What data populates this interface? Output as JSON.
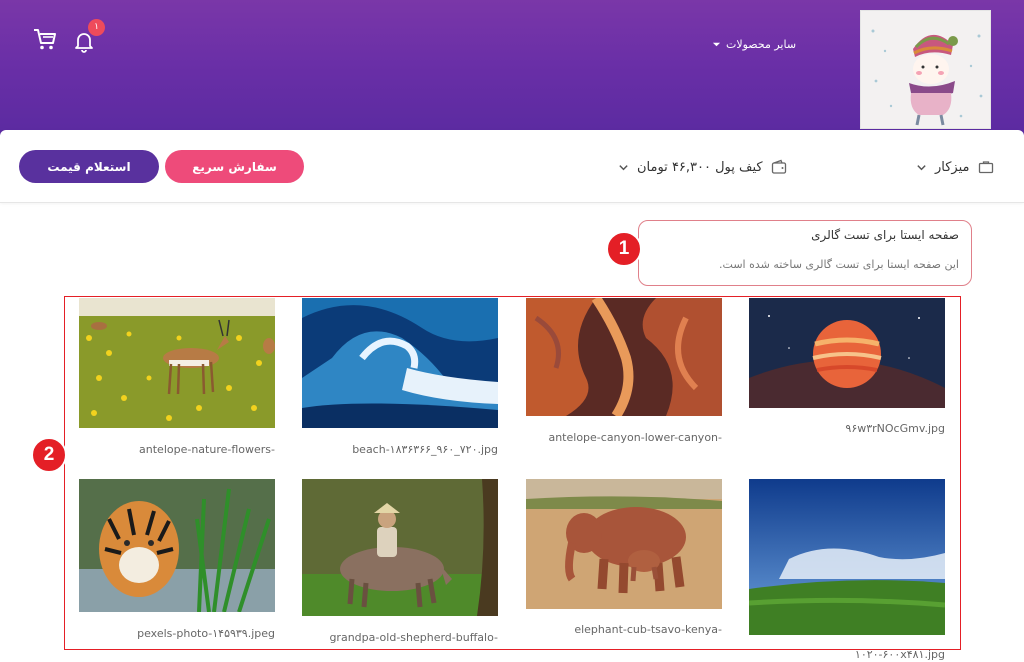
{
  "header": {
    "other_products_label": "سایر محصولات",
    "notification_count": "۱",
    "badge_color": "#ee4b5b",
    "gradient_colors": [
      "#7a37a8",
      "#5a2aa0"
    ]
  },
  "bar": {
    "table_label": "میزکار",
    "wallet_label": "کیف پول ۴۶,۳۰۰ تومان",
    "fast_order_label": "سفارش سریع",
    "price_inquiry_label": "استعلام قیمت",
    "fast_order_color": "#ee4b7a",
    "price_inquiry_color": "#59319e"
  },
  "page": {
    "title": "صفحه ایستا برای تست گالری",
    "description": "این صفحه ایستا برای تست گالری ساخته شده است."
  },
  "markers": {
    "first": "1",
    "second": "2",
    "color": "#e41f26"
  },
  "gallery": {
    "items": [
      {
        "caption": "antelope-nature-flowers-",
        "subject": "antelope in yellow flower field"
      },
      {
        "caption": "beach-۱۸۳۶۳۶۶_۹۶۰_۷۲۰.jpg",
        "subject": "ocean wave"
      },
      {
        "caption": "antelope-canyon-lower-canyon-",
        "subject": "red sandstone canyon"
      },
      {
        "caption": "۹۶w۳rNOcGmv.jpg",
        "subject": "glowing planet in space"
      },
      {
        "caption": "pexels-photo-۱۴۵۹۳۹.jpeg",
        "subject": "tiger by water and grass"
      },
      {
        "caption": "grandpa-old-shepherd-buffalo-",
        "subject": "old shepherd riding buffalo"
      },
      {
        "caption": "elephant-cub-tsavo-kenya-",
        "subject": "elephant with calf on savanna"
      },
      {
        "caption": "۱۰۲۰-۶۰۰x۴۸۱.jpg",
        "subject": "sky over green field"
      }
    ]
  }
}
